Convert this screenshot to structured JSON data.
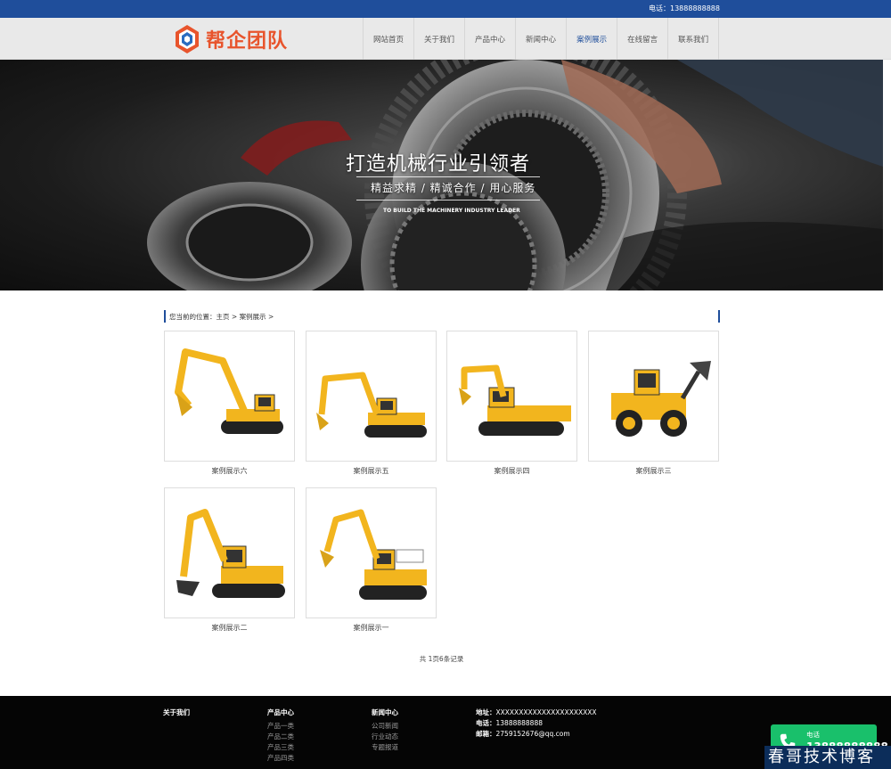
{
  "topbar": {
    "phone": "电话：13888888888"
  },
  "header": {
    "logo_text": "帮企团队",
    "nav": [
      {
        "label": "网站首页",
        "active": false
      },
      {
        "label": "关于我们",
        "active": false
      },
      {
        "label": "产品中心",
        "active": false
      },
      {
        "label": "新闻中心",
        "active": false
      },
      {
        "label": "案例展示",
        "active": true
      },
      {
        "label": "在线留言",
        "active": false
      },
      {
        "label": "联系我们",
        "active": false
      }
    ]
  },
  "banner": {
    "title": "打造机械行业引领者",
    "subtitle": "精益求精 / 精诚合作 / 用心服务",
    "english": "TO BUILD THE MACHINERY INDUSTRY LEADER"
  },
  "breadcrumb": {
    "prefix": "您当前的位置：",
    "home": "主页",
    "sep": " > ",
    "current": "案例展示",
    "tail": " >"
  },
  "cases": [
    {
      "caption": "案例展示六",
      "icon": "excavator-image"
    },
    {
      "caption": "案例展示五",
      "icon": "excavator-image"
    },
    {
      "caption": "案例展示四",
      "icon": "excavator-image"
    },
    {
      "caption": "案例展示三",
      "icon": "wheel-loader-image"
    },
    {
      "caption": "案例展示二",
      "icon": "excavator-image"
    },
    {
      "caption": "案例展示一",
      "icon": "excavator-image"
    }
  ],
  "pager": {
    "text": "共 1页6条记录"
  },
  "footer": {
    "about": {
      "title": "关于我们"
    },
    "products": {
      "title": "产品中心",
      "links": [
        "产品一类",
        "产品二类",
        "产品三类",
        "产品四类"
      ]
    },
    "news": {
      "title": "新闻中心",
      "links": [
        "公司新闻",
        "行业动态",
        "专题报道"
      ]
    },
    "contact": {
      "address_label": "地址：",
      "address": "XXXXXXXXXXXXXXXXXXXXXX",
      "phone_label": "电话：",
      "phone": "13888888888",
      "email_label": "邮箱：",
      "email": "2759152676@qq.com"
    }
  },
  "float_call": {
    "label": "电话",
    "number": "13888888888"
  },
  "watermark": {
    "text": "春哥技术博客"
  },
  "colors": {
    "brand_blue": "#1f4e9b",
    "logo_orange": "#e8542c",
    "call_green": "#19c06b",
    "excavator_yellow": "#f2b51e"
  }
}
